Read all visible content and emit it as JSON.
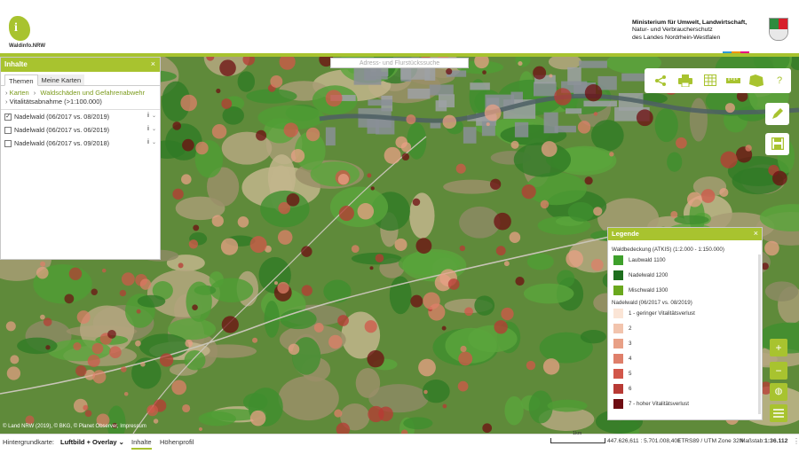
{
  "header": {
    "logo_text": "Waldinfo.NRW",
    "logo_glyph": "i",
    "ministry": [
      "Ministerium für Umwelt, Landwirtschaft,",
      "Natur- und Verbraucherschutz",
      "des Landes Nordrhein-Westfalen"
    ],
    "accent_color": "#a8c32f"
  },
  "search": {
    "placeholder": "Adress- und Flurstückssuche"
  },
  "panel": {
    "title": "Inhalte",
    "close": "×",
    "tabs": [
      {
        "label": "Themen"
      },
      {
        "label": "Meine Karten"
      }
    ],
    "breadcrumb": {
      "root": "Karten",
      "current": "Waldschäden und Gefahrenabwehr"
    },
    "subcrumb": "Vitalitätsabnahme (>1:100.000)",
    "layers": [
      {
        "label": "Nadelwald (06/2017 vs. 08/2019)",
        "checked": true,
        "check": "✓"
      },
      {
        "label": "Nadelwald (06/2017 vs. 06/2019)",
        "checked": false,
        "check": ""
      },
      {
        "label": "Nadelwald (06/2017 vs. 09/2018)",
        "checked": false,
        "check": ""
      }
    ]
  },
  "toolbar": {
    "icons": [
      "share-icon",
      "print-icon",
      "table-icon",
      "measure-icon",
      "overview-map-icon",
      "help-icon"
    ],
    "help_label": "?"
  },
  "side_buttons": [
    "draw-icon",
    "save-icon"
  ],
  "legend": {
    "title": "Legende",
    "close": "×",
    "group1_title": "Waldbedeckung (ATKIS) (1:2.000 - 1:150.000)",
    "group1": [
      {
        "label": "Laubwald 1100",
        "color": "#3ea02c"
      },
      {
        "label": "Nadelwald 1200",
        "color": "#1e6e1e"
      },
      {
        "label": "Mischwald 1300",
        "color": "#6aa81e"
      }
    ],
    "group2_title": "Nadelwald (06/2017 vs. 08/2019)",
    "group2": [
      {
        "label": "1 - geringer Vitalitätsverlust",
        "color": "#fbe5d6"
      },
      {
        "label": "2",
        "color": "#f2c4ad"
      },
      {
        "label": "3",
        "color": "#e8a086"
      },
      {
        "label": "4",
        "color": "#df7f6a"
      },
      {
        "label": "5",
        "color": "#d2574a"
      },
      {
        "label": "6",
        "color": "#b83a34"
      },
      {
        "label": "7 - hoher Vitalitätsverlust",
        "color": "#6e0d12"
      }
    ]
  },
  "zoom": {
    "in": "+",
    "out": "−"
  },
  "copyright": "© Land NRW (2019), © BKG, © Planet Observer, Impressum",
  "footer": {
    "background_label": "Hintergrundkarte:",
    "background_value": "Luftbild + Overlay ⌄",
    "tabs": [
      "Inhalte",
      "Höhenprofil"
    ],
    "scale_text": "1km",
    "coordinates": "447.626,611 : 5.701.008,401",
    "crs": "ETRS89 / UTM Zone 32N",
    "scale_label": "Maßstab:",
    "scale_value": "1:36.112",
    "more": "⋮"
  }
}
